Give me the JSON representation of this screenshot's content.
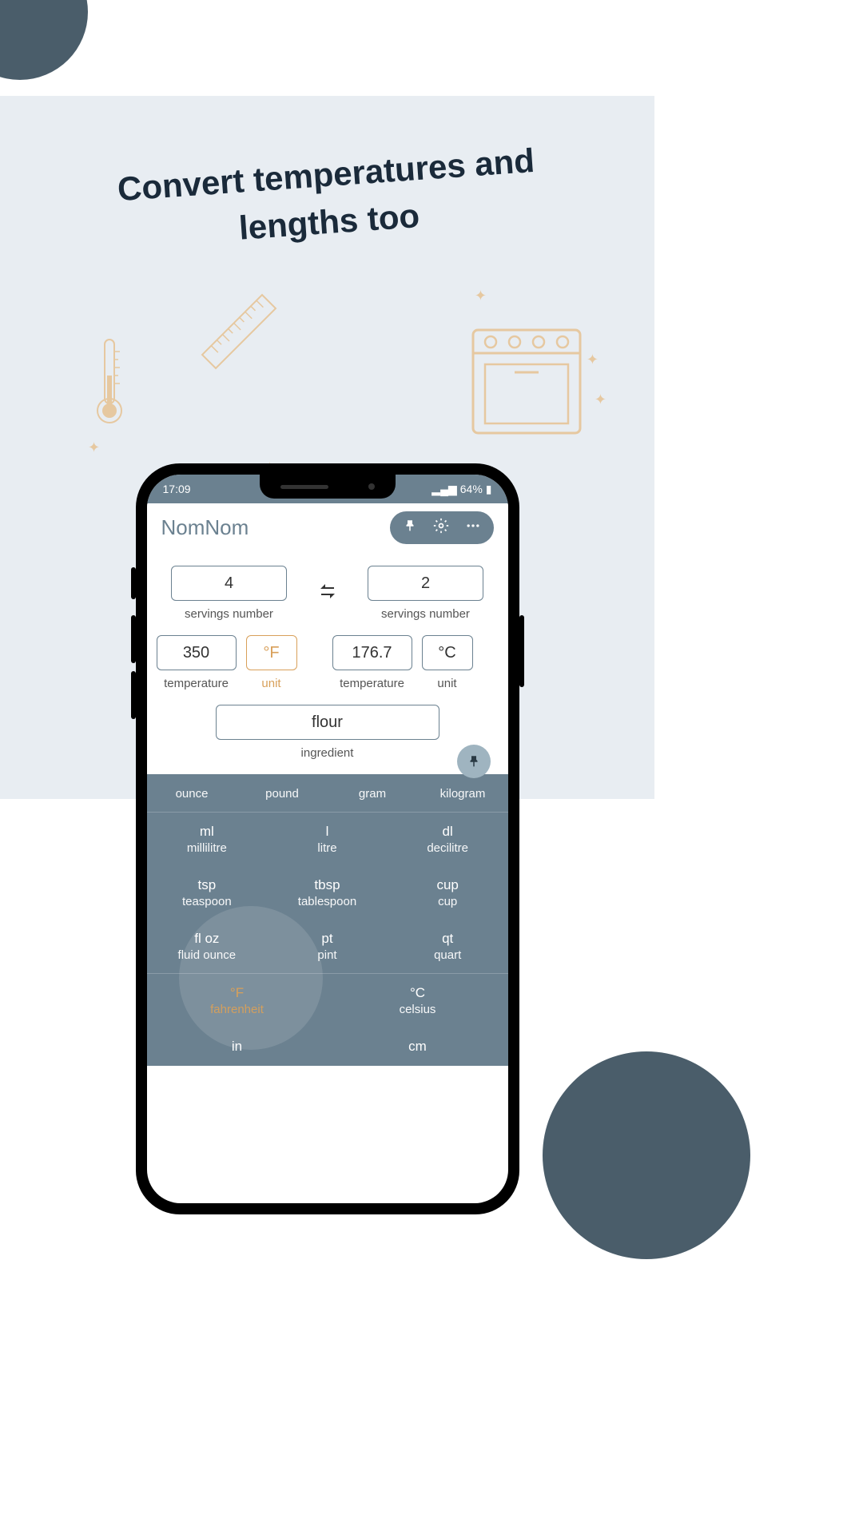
{
  "promo": {
    "headline": "Convert temperatures and lengths too"
  },
  "statusbar": {
    "time": "17:09",
    "battery": "64%"
  },
  "app": {
    "title": "NomNom"
  },
  "servings": {
    "left_value": "4",
    "right_value": "2",
    "label": "servings number"
  },
  "temperature": {
    "left_value": "350",
    "left_unit": "°F",
    "right_value": "176.7",
    "right_unit": "°C",
    "label": "temperature",
    "unit_label": "unit"
  },
  "ingredient": {
    "value": "flour",
    "label": "ingredient"
  },
  "units": {
    "mass": [
      {
        "abbr": "",
        "full": "ounce"
      },
      {
        "abbr": "",
        "full": "pound"
      },
      {
        "abbr": "",
        "full": "gram"
      },
      {
        "abbr": "",
        "full": "kilogram"
      }
    ],
    "volume_a": [
      {
        "abbr": "ml",
        "full": "millilitre"
      },
      {
        "abbr": "l",
        "full": "litre"
      },
      {
        "abbr": "dl",
        "full": "decilitre"
      }
    ],
    "volume_b": [
      {
        "abbr": "tsp",
        "full": "teaspoon"
      },
      {
        "abbr": "tbsp",
        "full": "tablespoon"
      },
      {
        "abbr": "cup",
        "full": "cup"
      }
    ],
    "volume_c": [
      {
        "abbr": "fl oz",
        "full": "fluid ounce"
      },
      {
        "abbr": "pt",
        "full": "pint"
      },
      {
        "abbr": "qt",
        "full": "quart"
      }
    ],
    "temp": [
      {
        "abbr": "°F",
        "full": "fahrenheit"
      },
      {
        "abbr": "°C",
        "full": "celsius"
      }
    ],
    "length": [
      {
        "abbr": "in",
        "full": ""
      },
      {
        "abbr": "cm",
        "full": ""
      }
    ]
  }
}
